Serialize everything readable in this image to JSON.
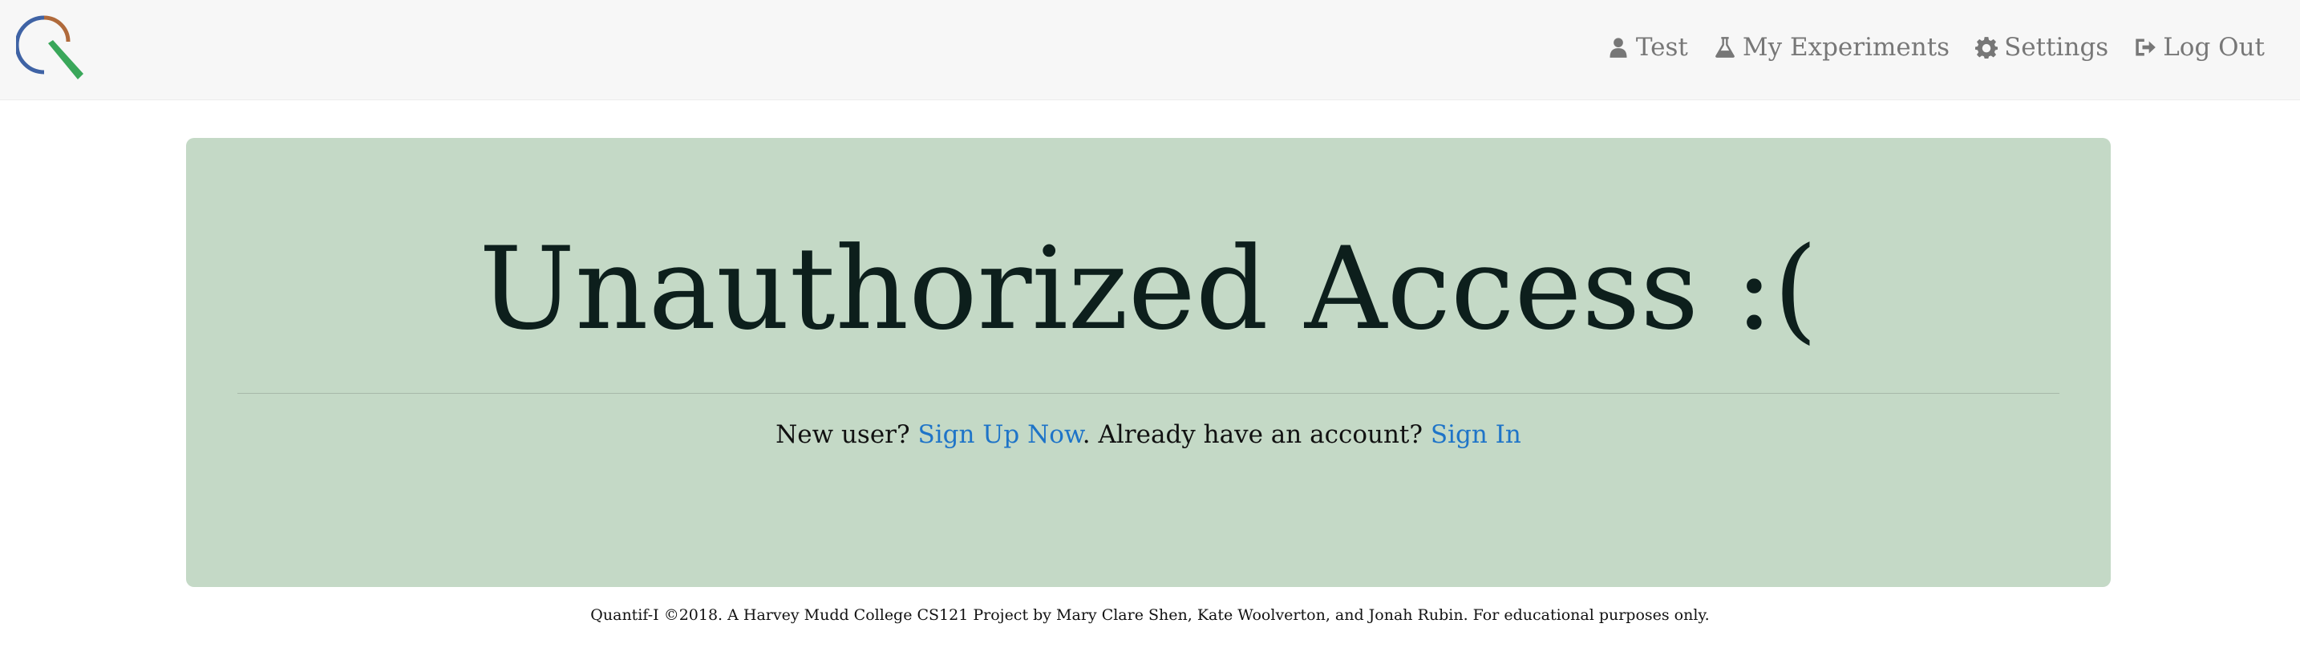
{
  "navbar": {
    "logo_name": "Quantif-I logo",
    "links": [
      {
        "label": "Test",
        "icon": "user-icon"
      },
      {
        "label": "My Experiments",
        "icon": "flask-icon"
      },
      {
        "label": "Settings",
        "icon": "gear-icon"
      },
      {
        "label": "Log Out",
        "icon": "sign-out-icon"
      }
    ],
    "colors": {
      "background": "#f7f7f7",
      "link": "#777777"
    }
  },
  "main": {
    "heading": "Unauthorized Access :(",
    "prompt_new_user": "New user?",
    "signup_link": "Sign Up Now",
    "prompt_existing": ". Already have an account?",
    "signin_link": "Sign In",
    "colors": {
      "panel": "#c4d9c6",
      "link": "#1e74c8"
    }
  },
  "footer": {
    "text": "Quantif-I ©2018. A Harvey Mudd College CS121 Project by Mary Clare Shen, Kate Woolverton, and Jonah Rubin. For educational purposes only."
  }
}
